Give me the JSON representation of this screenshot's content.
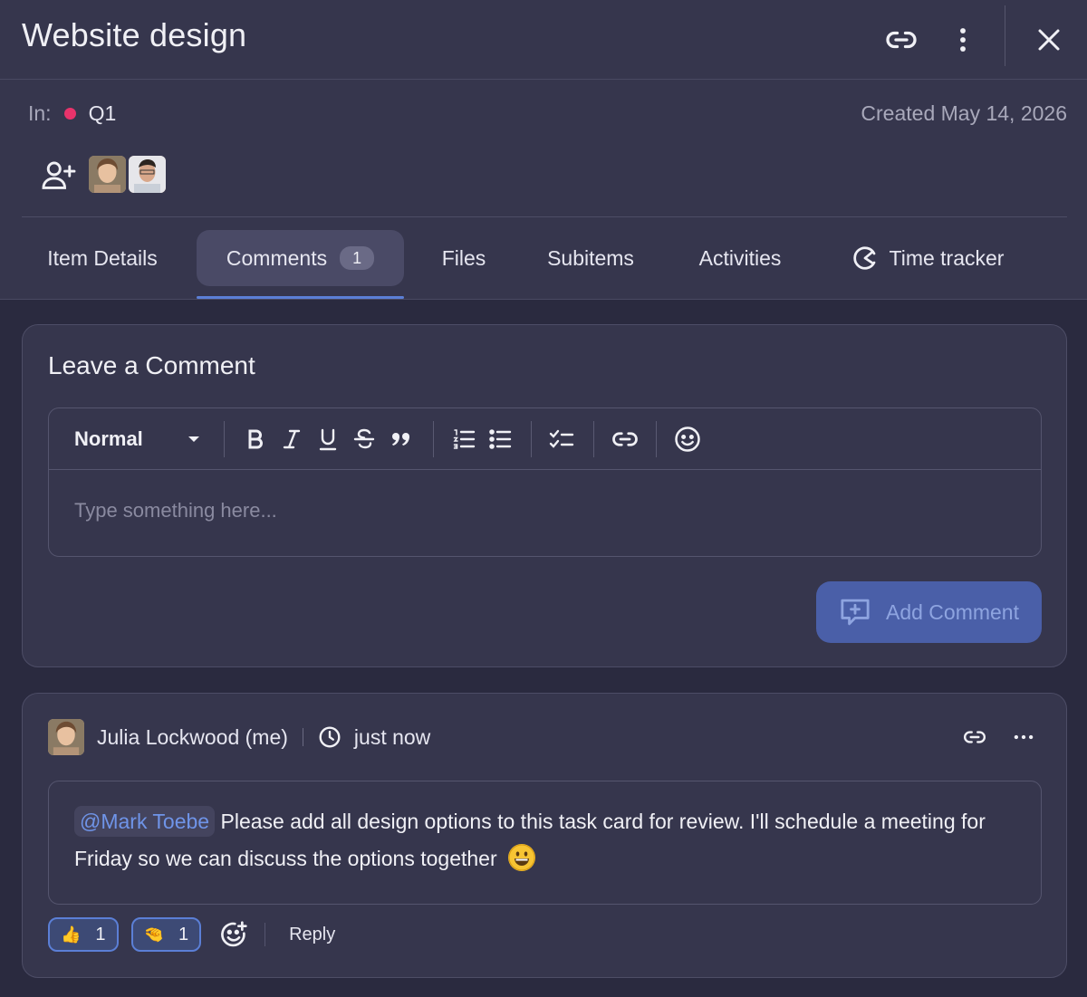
{
  "header": {
    "title": "Website design",
    "icons": [
      "link-icon",
      "more-vertical-icon",
      "close-icon"
    ]
  },
  "meta": {
    "in_label": "In:",
    "group_name": "Q1",
    "group_color": "#e8336b",
    "created": "Created May 14, 2026"
  },
  "tabs": [
    {
      "label": "Item Details"
    },
    {
      "label": "Comments",
      "badge": "1",
      "active": true
    },
    {
      "label": "Files"
    },
    {
      "label": "Subitems"
    },
    {
      "label": "Activities"
    },
    {
      "label": "Time tracker",
      "icon": "time-tracker-icon"
    }
  ],
  "composer": {
    "title": "Leave a Comment",
    "format_value": "Normal",
    "placeholder": "Type something here...",
    "submit_label": "Add Comment",
    "toolbar_icons": [
      "bold-icon",
      "italic-icon",
      "underline-icon",
      "strikethrough-icon",
      "quote-icon",
      "ordered-list-icon",
      "bullet-list-icon",
      "checklist-icon",
      "link-icon",
      "emoji-icon"
    ]
  },
  "comment": {
    "author": "Julia Lockwood (me)",
    "time": "just now",
    "mention": "@Mark Toebe",
    "text": " Please add all design options to this task card for review. I'll schedule a meeting for Friday so we can discuss the options together",
    "reactions": [
      {
        "emoji": "👍",
        "count": "1"
      },
      {
        "emoji": "🤏",
        "count": "1"
      }
    ],
    "reply_label": "Reply"
  },
  "colors": {
    "accent": "#5b7fd6",
    "mention": "#6f94e8",
    "button": "#4a5fa8"
  }
}
